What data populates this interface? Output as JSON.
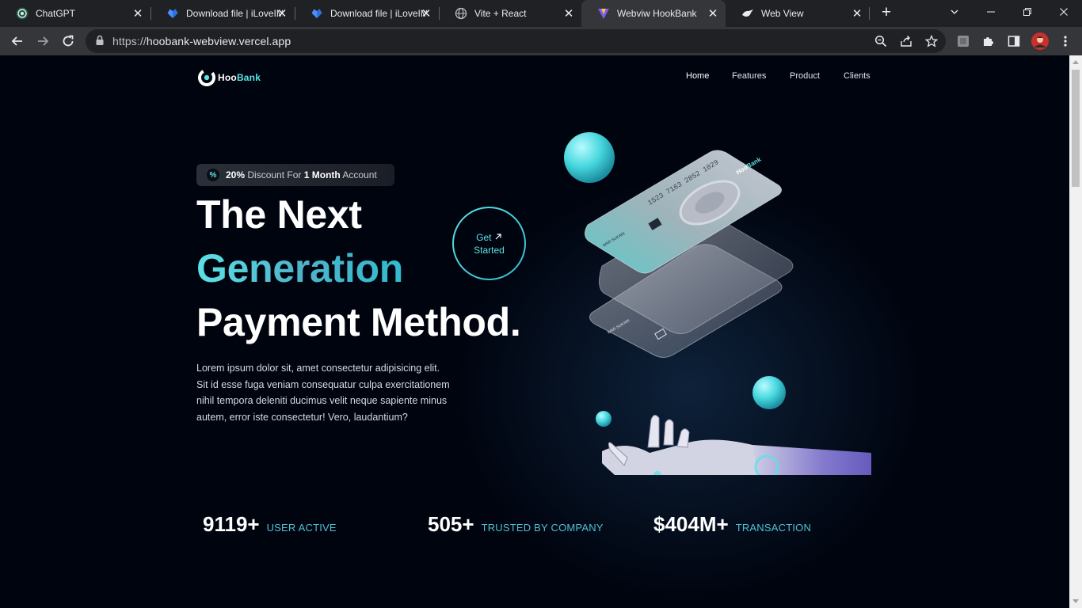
{
  "browser": {
    "tabs": [
      {
        "title": "ChatGPT",
        "icon": "chatgpt-icon"
      },
      {
        "title": "Download file | iLoveIMG",
        "icon": "ilovepdf-heart-icon"
      },
      {
        "title": "Download file | iLoveIMG",
        "icon": "ilovepdf-heart-icon"
      },
      {
        "title": "Vite + React",
        "icon": "globe-icon"
      },
      {
        "title": "Webviw HookBank",
        "icon": "vite-icon",
        "active": true
      },
      {
        "title": "Web View",
        "icon": "bird-icon"
      }
    ],
    "url_scheme": "https://",
    "url_host": "hoobank-webview.vercel.app"
  },
  "site": {
    "logo": {
      "hoo": "Hoo",
      "bank": "Bank"
    },
    "nav": [
      "Home",
      "Features",
      "Product",
      "Clients"
    ],
    "discount": {
      "percent": "20%",
      "mid": "Discount For",
      "period": "1 Month",
      "suffix": "Account"
    },
    "heading": {
      "line1": "The Next",
      "line2": "Generation",
      "line3": "Payment Method."
    },
    "cta": {
      "line1": "Get",
      "line2": "Started"
    },
    "description": "Lorem ipsum dolor sit, amet consectetur adipisicing elit. Sit id esse fuga veniam consequatur culpa exercitationem nihil tempora deleniti ducimus velit neque sapiente minus autem, error iste consectetur! Vero, laudantium?",
    "stats": [
      {
        "value": "9119+",
        "label": "USER ACTIVE"
      },
      {
        "value": "505+",
        "label": "TRUSTED BY COMPANY"
      },
      {
        "value": "$404M+",
        "label": "TRANSACTION"
      }
    ],
    "card": {
      "number": "1523 7163 2852 1029",
      "holder": "WAR SUKARI",
      "brand_hoo": "Hoo",
      "brand_bank": "Bank"
    }
  },
  "colors": {
    "accent": "#5ce1e6",
    "background": "#00040f"
  }
}
